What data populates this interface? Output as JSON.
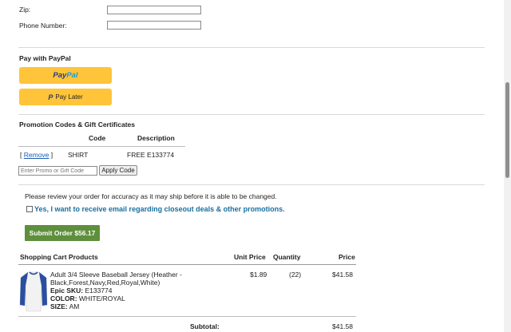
{
  "address": {
    "zip_label": "Zip:",
    "zip_value": "",
    "phone_label": "Phone Number:",
    "phone_value": ""
  },
  "paypal": {
    "section_title": "Pay with PayPal",
    "logo_part1": "Pay",
    "logo_part2": "Pal",
    "paylater_label": "Pay Later",
    "button_color": "#ffc439"
  },
  "promo": {
    "section_title": "Promotion Codes & Gift Certificates",
    "col_code": "Code",
    "col_description": "Description",
    "row": {
      "remove_open": "[",
      "remove_label": "Remove",
      "remove_close": "]",
      "code": "SHIRT",
      "description": "FREE E133774"
    },
    "input_placeholder": "Enter Promo or Gift Code",
    "apply_label": "Apply Code"
  },
  "review": {
    "notice": "Please review your order for accuracy as it may ship before it is able to be changed.",
    "email_opt_label": "Yes, I want to receive email regarding closeout deals & other promotions.",
    "email_opt_checked": false
  },
  "submit": {
    "label": "Submit Order $56.17",
    "color": "#5e8f3c"
  },
  "cart": {
    "header_products": "Shopping Cart Products",
    "header_unit_price": "Unit Price",
    "header_quantity": "Quantity",
    "header_price": "Price",
    "item": {
      "title_line1": "Adult 3/4 Sleeve Baseball Jersey (Heather -",
      "title_line2": "Black,Forest,Navy,Red,Royal,White)",
      "sku_label": "Epic SKU:",
      "sku_value": "E133774",
      "color_label": "COLOR:",
      "color_value": "WHITE/ROYAL",
      "size_label": "SIZE:",
      "size_value": "AM",
      "unit_price": "$1.89",
      "quantity": "(22)",
      "price": "$41.58",
      "image_icon": "baseball-jersey-icon"
    },
    "subtotal_label": "Subtotal:",
    "subtotal_value": "$41.58"
  }
}
